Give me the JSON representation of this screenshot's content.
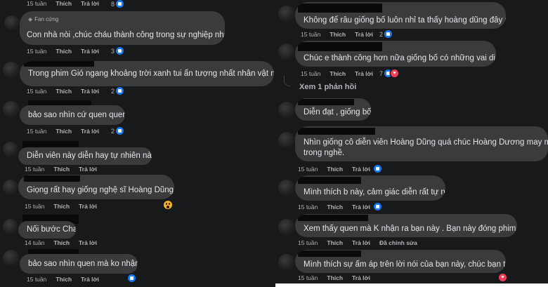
{
  "left": {
    "top_actions": {
      "time": "15 tuần",
      "like": "Thích",
      "reply": "Trả lời",
      "count": "8"
    },
    "comments": [
      {
        "badge": "Fan cứng",
        "text": "Con nhà nòi ,chúc cháu thành công trong sự nghiệp nha",
        "time": "15 tuần",
        "like": "Thích",
        "reply": "Trả lời",
        "count": "3"
      },
      {
        "text": "Trong phim Gió ngang khoảng trời xanh tui ấn tượng nhất nhân vật này...",
        "time": "15 tuần",
        "like": "Thích",
        "reply": "Trả lời",
        "count": "2"
      },
      {
        "text": "bảo sao nhìn cứ quen quen",
        "time": "15 tuần",
        "like": "Thích",
        "reply": "Trả lời",
        "count": "2"
      },
      {
        "text": "Diễn viên này diễn hay tự nhiên này",
        "time": "15 tuần",
        "like": "Thích",
        "reply": "Trả lời"
      },
      {
        "text": "Giọng rất hay giống nghệ sĩ Hoàng Dũng quá",
        "time": "15 tuần",
        "like": "Thích",
        "reply": "Trả lời"
      },
      {
        "text": "Nối bước Cha",
        "time": "14 tuần",
        "like": "Thích",
        "reply": "Trả lời"
      },
      {
        "text": "bảo sao nhìn quen mà ko nhận ra",
        "time": "15 tuần",
        "like": "Thích",
        "reply": "Trả lời"
      }
    ]
  },
  "right": {
    "comments": [
      {
        "text": "Không để râu giống bố luôn nhỉ ta thấy hoàng dũng đây rồi kk",
        "time": "15 tuần",
        "like": "Thích",
        "reply": "Trả lời",
        "count": "2"
      },
      {
        "text": "Chúc e thành công hơn nữa giống bố có những vai diễn để đời",
        "time": "15 tuần",
        "like": "Thích",
        "reply": "Trả lời",
        "count": "7"
      },
      {
        "text": "Diễn đạt , giống bố"
      },
      {
        "text1": "Nhìn giống cô diễn viên Hoàng Dũng quá chúc Hoàng Dương may mắn thành công",
        "text2": "trong nghề.",
        "time": "15 tuần",
        "like": "Thích",
        "reply": "Trả lời"
      },
      {
        "text": "Mình thích b này, cảm giác diễn rất tự nhiên!",
        "time": "15 tuần",
        "like": "Thích",
        "reply": "Trả lời"
      },
      {
        "text": "Xem thấy quen mà K nhận ra bạn này . Bạn này đóng phim này rất ok",
        "time": "15 tuần",
        "like": "Thích",
        "reply": "Trả lời",
        "edit": "Đã chỉnh sửa"
      },
      {
        "text": "Mình thích sự ấm áp trên lời nói của bạn này, chúc bạn thành công",
        "time": "15 tuần",
        "like": "Thích",
        "reply": "Trả lời"
      }
    ],
    "view_replies": "Xem 1 phản hồi"
  },
  "colors": {
    "bg": "#18191a",
    "bubble": "#3a3b3c",
    "text": "#e4e6eb",
    "meta": "#b0b3b8",
    "like": "#1877f2",
    "love": "#f33e58",
    "wow": "#f7b125"
  }
}
